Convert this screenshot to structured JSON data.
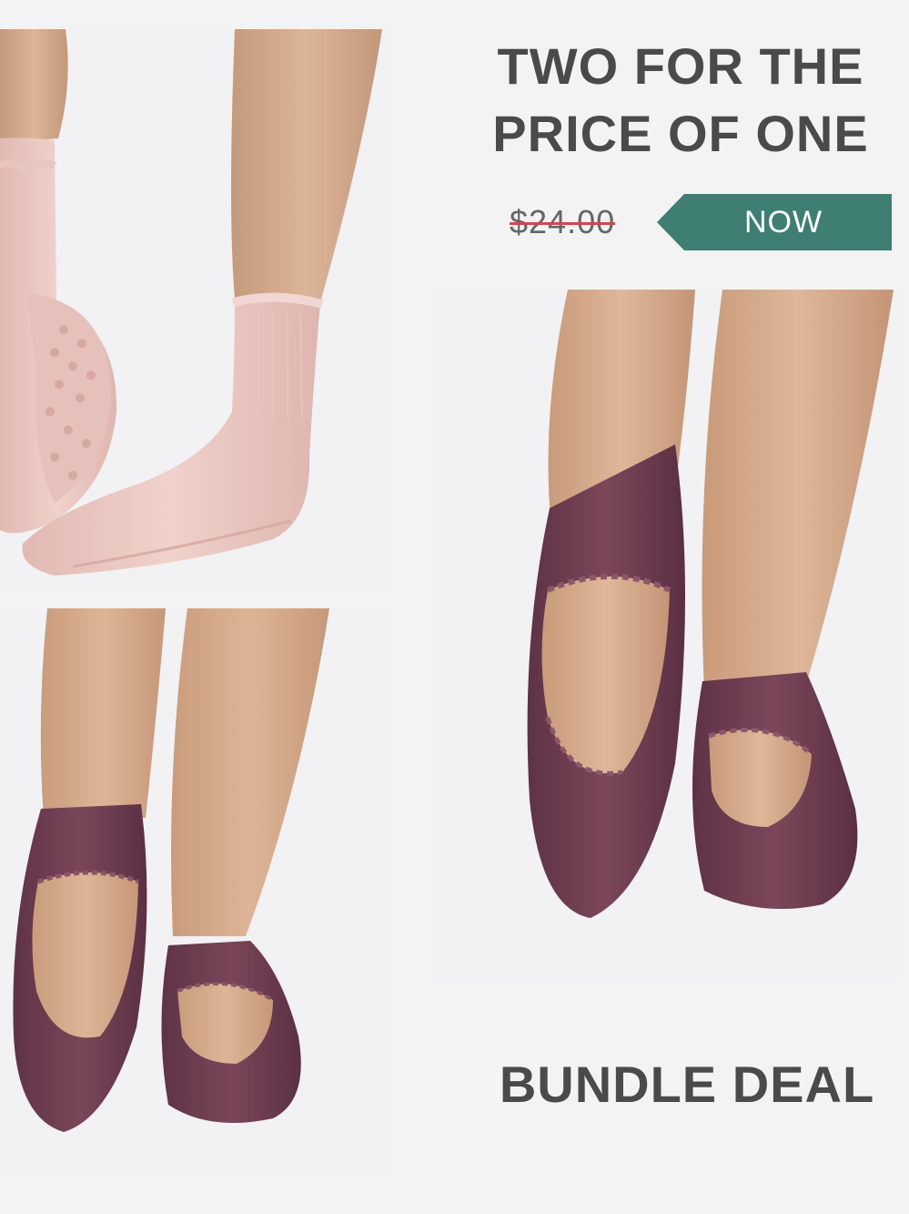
{
  "promo": {
    "headline_line1": "TWO FOR THE",
    "headline_line2": "PRICE OF ONE",
    "old_price": "$24.00",
    "now_label": "NOW",
    "bundle_label": "BUNDLE DEAL"
  },
  "colors": {
    "now_badge": "#3f7e73",
    "strike_line": "#cc4b4b",
    "headline_text": "#4a4a4a",
    "pink_sock": "#ebc7c3",
    "plum_sock": "#6e3e52",
    "skin": "#d2a98a"
  },
  "images": [
    {
      "name": "pink-ruffle-crew-grip-socks-photo"
    },
    {
      "name": "plum-ballet-grip-socks-photo"
    },
    {
      "name": "plum-ballet-grip-socks-closeup-photo"
    }
  ]
}
